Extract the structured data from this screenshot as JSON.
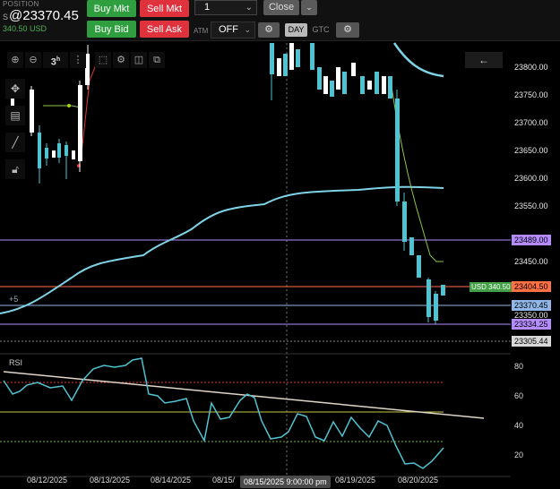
{
  "position": {
    "label": "POSITION",
    "prefix": "S",
    "price": "@23370.45",
    "pnl": "340.50 USD"
  },
  "orders": {
    "buy_mkt": "Buy Mkt",
    "sell_mkt": "Sell Mkt",
    "buy_bid": "Buy Bid",
    "sell_ask": "Sell Ask",
    "quantity": "1",
    "close": "Close",
    "atm_label": "ATM",
    "atm_value": "OFF",
    "tif_day": "DAY",
    "tif_gtc": "GTC"
  },
  "toolbar": {
    "bars_value": "3",
    "bars_unit": "h"
  },
  "colors": {
    "up": "#4fc3d1",
    "down": "#ffffff",
    "accent_green": "#2e9e3e",
    "accent_red": "#e0323d",
    "vwap": "#7fd3e6",
    "resistance": "#b48cff",
    "entry": "#ff7043",
    "rsi": "#4fc3d1"
  },
  "price_axis": {
    "labels": [
      "23800.00",
      "23750.00",
      "23700.00",
      "23650.00",
      "23600.00",
      "23550.00",
      "23450.00",
      "23350.00"
    ],
    "tags": {
      "resistance": "23489.00",
      "entry_pnl": "USD 340.50",
      "entry": "23404.50",
      "last": "23370.45",
      "support": "23334.25",
      "low": "23305.44"
    },
    "offset_label": "+5"
  },
  "rsi": {
    "label": "RSI",
    "levels": [
      "80",
      "60",
      "40",
      "20"
    ]
  },
  "time_axis": {
    "labels": [
      "08/12/2025",
      "08/13/2025",
      "08/14/2025",
      "08/15/",
      "08/19/2025",
      "08/20/2025"
    ],
    "crosshair": "08/15/2025 9:00:00 pm"
  }
}
